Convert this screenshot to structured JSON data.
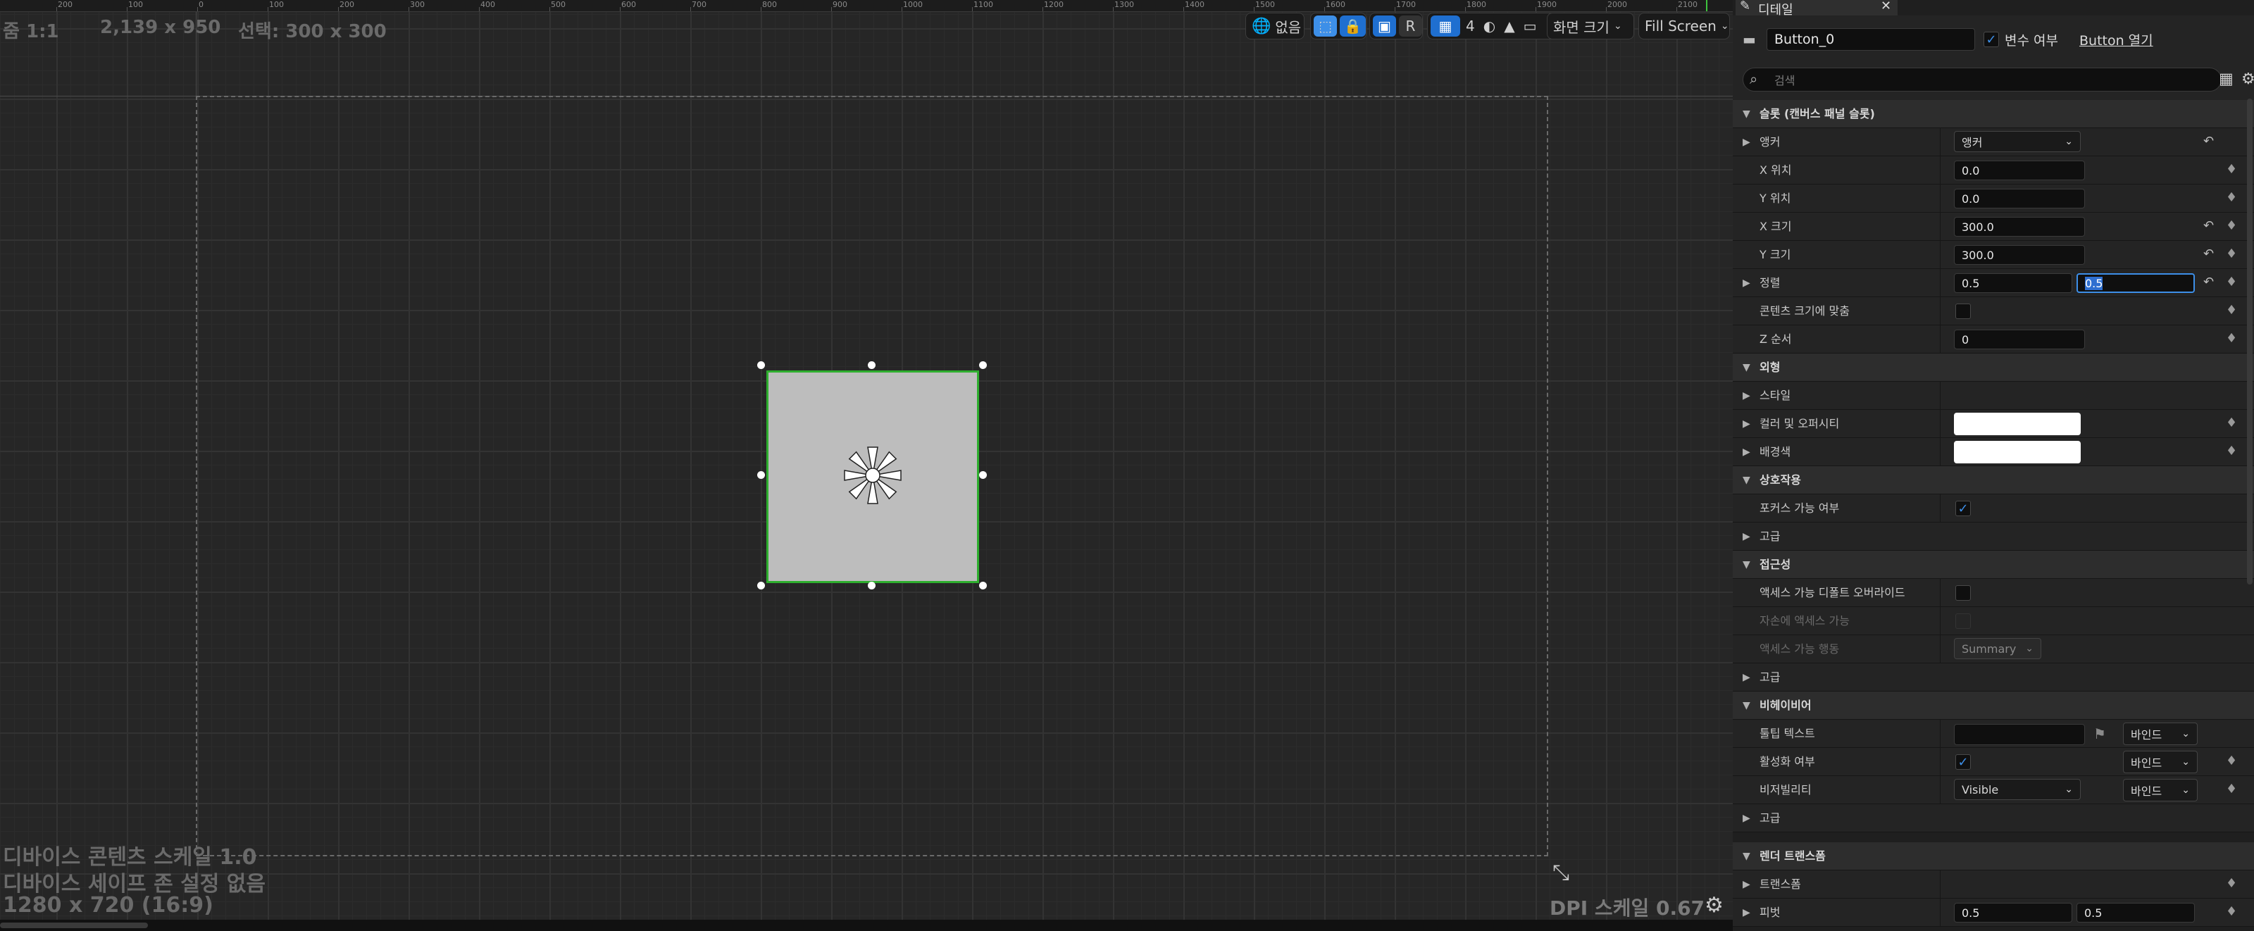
{
  "ruler": {
    "labels": [
      "200",
      "100",
      "0",
      "100",
      "200",
      "300",
      "400",
      "500",
      "600",
      "700",
      "800",
      "900",
      "1000",
      "1100",
      "1200",
      "1300",
      "1400",
      "1500",
      "1600",
      "1700",
      "1800",
      "1900",
      "2000",
      "2100"
    ]
  },
  "designer": {
    "zoom": "줌 1:1",
    "resolution": "2,139 x 950",
    "selection": "선택: 300 x 300",
    "device_content_scale": "디바이스 콘텐츠 스케일 1.0",
    "device_safe_zone": "디바이스 세이프 존 설정 없음",
    "screen_resolution": "1280 x 720 (16:9)",
    "dpi_scale": "DPI 스케일 0.67"
  },
  "toolbar": {
    "none_label": "없음",
    "r_label": "R",
    "grid_value": "4",
    "screen_size_label": "화면 크기",
    "fill_screen_label": "Fill Screen"
  },
  "details": {
    "tab_label": "디테일",
    "widget_name": "Button_0",
    "is_variable_label": "변수 여부",
    "open_button_label": "Button 열기",
    "search_placeholder": "검색",
    "slot_section": "슬롯 (캔버스 패널 슬롯)",
    "anchor_label": "앵커",
    "anchor_value": "앵커",
    "x_pos_label": "X 위치",
    "x_pos_value": "0.0",
    "y_pos_label": "Y 위치",
    "y_pos_value": "0.0",
    "x_size_label": "X 크기",
    "x_size_value": "300.0",
    "y_size_label": "Y 크기",
    "y_size_value": "300.0",
    "alignment_label": "정렬",
    "alignment_x": "0.5",
    "alignment_y": "0.5",
    "size_to_content_label": "콘텐츠 크기에 맞춤",
    "z_order_label": "Z 순서",
    "z_order_value": "0",
    "appearance_section": "외형",
    "style_label": "스타일",
    "color_opacity_label": "컬러 및 오퍼시티",
    "background_color_label": "배경색",
    "interaction_section": "상호작용",
    "is_focusable_label": "포커스 가능 여부",
    "advanced_label": "고급",
    "accessibility_section": "접근성",
    "override_accessible_label": "액세스 가능 디폴트 오버라이드",
    "can_children_accessible_label": "자손에 액세스 가능",
    "accessible_behavior_label": "액세스 가능 행동",
    "accessible_behavior_value": "Summary",
    "behavior_section": "비헤이비어",
    "tooltip_text_label": "툴팁 텍스트",
    "bind_label": "바인드",
    "is_enabled_label": "활성화 여부",
    "visibility_label": "비저빌리티",
    "visibility_value": "Visible",
    "render_transform_section": "렌더 트랜스폼",
    "transform_label": "트랜스폼",
    "pivot_label": "피벗",
    "pivot_x": "0.5",
    "pivot_y": "0.5"
  }
}
